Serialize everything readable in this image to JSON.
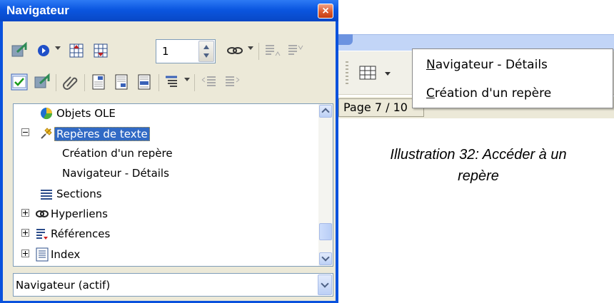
{
  "navigator": {
    "title": "Navigateur",
    "close_label": "×",
    "toolbar": {
      "page_spin_value": "1"
    },
    "tree_items": [
      {
        "label": "Objets OLE",
        "icon": "ole-objects-icon",
        "expander": "none",
        "indent": 0
      },
      {
        "label": "Repères de texte",
        "icon": "bookmark-pin-icon",
        "expander": "minus",
        "indent": 0,
        "selected": true
      },
      {
        "label": "Création d'un repère",
        "icon": "",
        "expander": "none",
        "indent": 1
      },
      {
        "label": "Navigateur - Détails",
        "icon": "",
        "expander": "none",
        "indent": 1
      },
      {
        "label": "Sections",
        "icon": "sections-icon",
        "expander": "none",
        "indent": 0
      },
      {
        "label": "Hyperliens",
        "icon": "hyperlinks-chain-icon",
        "expander": "plus",
        "indent": 0
      },
      {
        "label": "Références",
        "icon": "references-icon",
        "expander": "plus",
        "indent": 0
      },
      {
        "label": "Index",
        "icon": "index-icon",
        "expander": "plus",
        "indent": 0
      }
    ],
    "document_combo": "Navigateur (actif)"
  },
  "right_panel": {
    "page_indicator": "Page 7 / 10",
    "popup_menu": [
      {
        "underline": "N",
        "rest": "avigateur - Détails"
      },
      {
        "underline": "C",
        "rest": "réation d'un repère"
      }
    ]
  },
  "caption": {
    "line1": "Illustration 32: Accéder à un",
    "line2": "repère"
  },
  "colors": {
    "title_bar": "#0b56e0",
    "window_face": "#ece9d8",
    "selection": "#316ac5",
    "close_button": "#db5a2e"
  }
}
